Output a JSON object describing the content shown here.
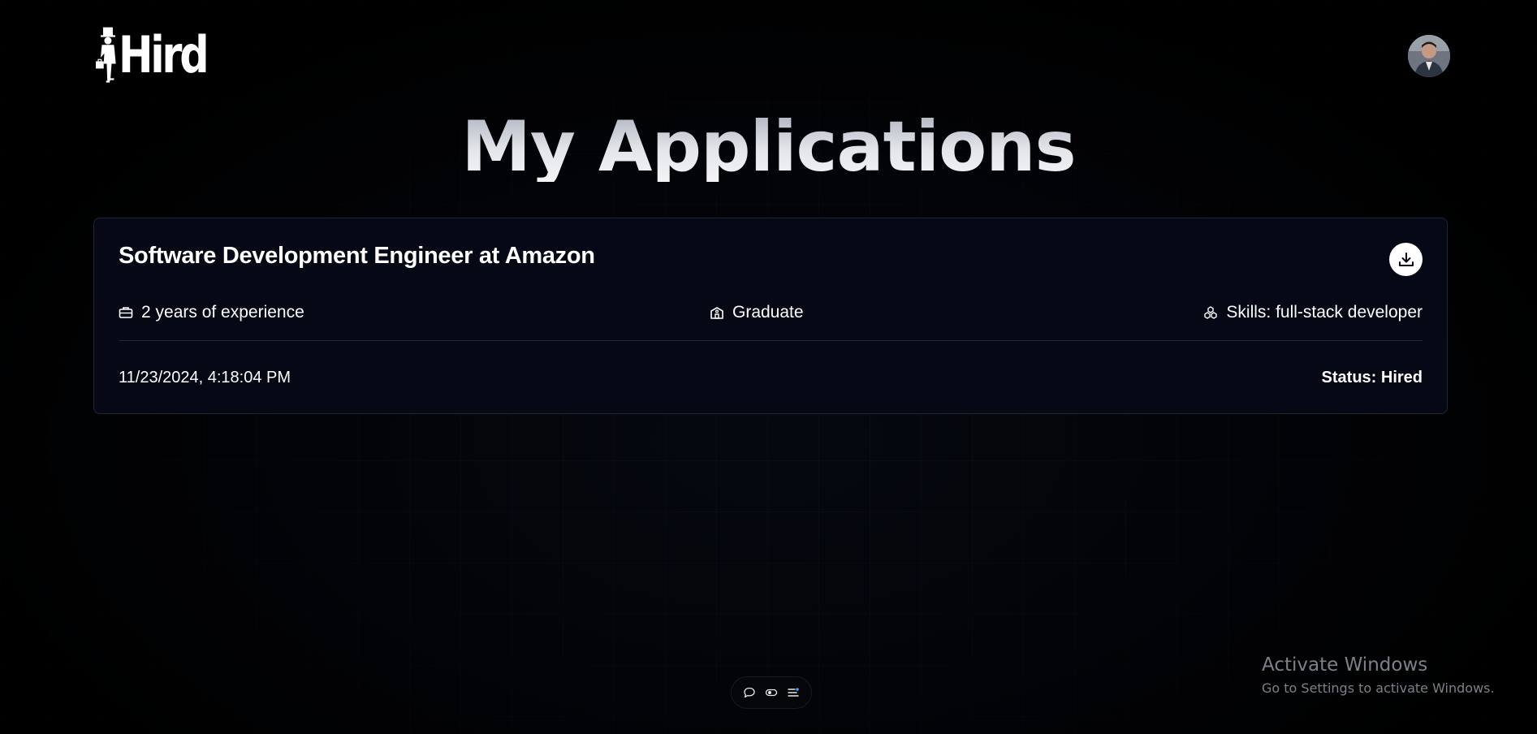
{
  "header": {
    "logo_text": "Hird",
    "avatar_alt": "user avatar"
  },
  "page": {
    "title": "My Applications"
  },
  "application": {
    "title": "Software Development Engineer at Amazon",
    "experience": "2 years of experience",
    "education": "Graduate",
    "skills": "Skills: full-stack developer",
    "date": "11/23/2024, 4:18:04 PM",
    "status": "Status: Hired"
  },
  "toolbar": {
    "icons": [
      "chat-icon",
      "toggle-icon",
      "filter-list-icon"
    ]
  },
  "watermark": {
    "title": "Activate Windows",
    "subtitle": "Go to Settings to activate Windows."
  },
  "colors": {
    "background": "#030407",
    "card": "#050916",
    "card_border": "#1f2533",
    "text": "#ffffff",
    "watermark": "#7d8088"
  }
}
